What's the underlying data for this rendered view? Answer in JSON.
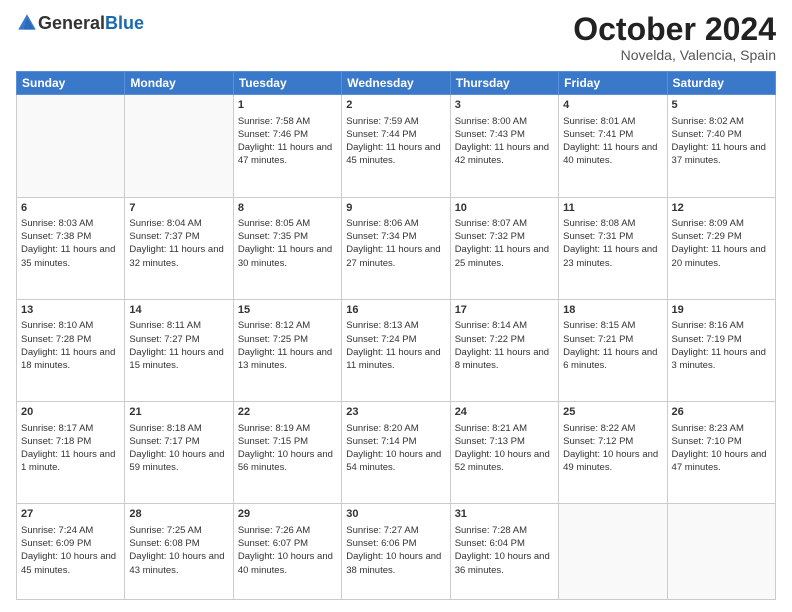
{
  "header": {
    "logo_general": "General",
    "logo_blue": "Blue",
    "title": "October 2024",
    "location": "Novelda, Valencia, Spain"
  },
  "days_of_week": [
    "Sunday",
    "Monday",
    "Tuesday",
    "Wednesday",
    "Thursday",
    "Friday",
    "Saturday"
  ],
  "weeks": [
    [
      {
        "day": "",
        "info": ""
      },
      {
        "day": "",
        "info": ""
      },
      {
        "day": "1",
        "info": "Sunrise: 7:58 AM\nSunset: 7:46 PM\nDaylight: 11 hours and 47 minutes."
      },
      {
        "day": "2",
        "info": "Sunrise: 7:59 AM\nSunset: 7:44 PM\nDaylight: 11 hours and 45 minutes."
      },
      {
        "day": "3",
        "info": "Sunrise: 8:00 AM\nSunset: 7:43 PM\nDaylight: 11 hours and 42 minutes."
      },
      {
        "day": "4",
        "info": "Sunrise: 8:01 AM\nSunset: 7:41 PM\nDaylight: 11 hours and 40 minutes."
      },
      {
        "day": "5",
        "info": "Sunrise: 8:02 AM\nSunset: 7:40 PM\nDaylight: 11 hours and 37 minutes."
      }
    ],
    [
      {
        "day": "6",
        "info": "Sunrise: 8:03 AM\nSunset: 7:38 PM\nDaylight: 11 hours and 35 minutes."
      },
      {
        "day": "7",
        "info": "Sunrise: 8:04 AM\nSunset: 7:37 PM\nDaylight: 11 hours and 32 minutes."
      },
      {
        "day": "8",
        "info": "Sunrise: 8:05 AM\nSunset: 7:35 PM\nDaylight: 11 hours and 30 minutes."
      },
      {
        "day": "9",
        "info": "Sunrise: 8:06 AM\nSunset: 7:34 PM\nDaylight: 11 hours and 27 minutes."
      },
      {
        "day": "10",
        "info": "Sunrise: 8:07 AM\nSunset: 7:32 PM\nDaylight: 11 hours and 25 minutes."
      },
      {
        "day": "11",
        "info": "Sunrise: 8:08 AM\nSunset: 7:31 PM\nDaylight: 11 hours and 23 minutes."
      },
      {
        "day": "12",
        "info": "Sunrise: 8:09 AM\nSunset: 7:29 PM\nDaylight: 11 hours and 20 minutes."
      }
    ],
    [
      {
        "day": "13",
        "info": "Sunrise: 8:10 AM\nSunset: 7:28 PM\nDaylight: 11 hours and 18 minutes."
      },
      {
        "day": "14",
        "info": "Sunrise: 8:11 AM\nSunset: 7:27 PM\nDaylight: 11 hours and 15 minutes."
      },
      {
        "day": "15",
        "info": "Sunrise: 8:12 AM\nSunset: 7:25 PM\nDaylight: 11 hours and 13 minutes."
      },
      {
        "day": "16",
        "info": "Sunrise: 8:13 AM\nSunset: 7:24 PM\nDaylight: 11 hours and 11 minutes."
      },
      {
        "day": "17",
        "info": "Sunrise: 8:14 AM\nSunset: 7:22 PM\nDaylight: 11 hours and 8 minutes."
      },
      {
        "day": "18",
        "info": "Sunrise: 8:15 AM\nSunset: 7:21 PM\nDaylight: 11 hours and 6 minutes."
      },
      {
        "day": "19",
        "info": "Sunrise: 8:16 AM\nSunset: 7:19 PM\nDaylight: 11 hours and 3 minutes."
      }
    ],
    [
      {
        "day": "20",
        "info": "Sunrise: 8:17 AM\nSunset: 7:18 PM\nDaylight: 11 hours and 1 minute."
      },
      {
        "day": "21",
        "info": "Sunrise: 8:18 AM\nSunset: 7:17 PM\nDaylight: 10 hours and 59 minutes."
      },
      {
        "day": "22",
        "info": "Sunrise: 8:19 AM\nSunset: 7:15 PM\nDaylight: 10 hours and 56 minutes."
      },
      {
        "day": "23",
        "info": "Sunrise: 8:20 AM\nSunset: 7:14 PM\nDaylight: 10 hours and 54 minutes."
      },
      {
        "day": "24",
        "info": "Sunrise: 8:21 AM\nSunset: 7:13 PM\nDaylight: 10 hours and 52 minutes."
      },
      {
        "day": "25",
        "info": "Sunrise: 8:22 AM\nSunset: 7:12 PM\nDaylight: 10 hours and 49 minutes."
      },
      {
        "day": "26",
        "info": "Sunrise: 8:23 AM\nSunset: 7:10 PM\nDaylight: 10 hours and 47 minutes."
      }
    ],
    [
      {
        "day": "27",
        "info": "Sunrise: 7:24 AM\nSunset: 6:09 PM\nDaylight: 10 hours and 45 minutes."
      },
      {
        "day": "28",
        "info": "Sunrise: 7:25 AM\nSunset: 6:08 PM\nDaylight: 10 hours and 43 minutes."
      },
      {
        "day": "29",
        "info": "Sunrise: 7:26 AM\nSunset: 6:07 PM\nDaylight: 10 hours and 40 minutes."
      },
      {
        "day": "30",
        "info": "Sunrise: 7:27 AM\nSunset: 6:06 PM\nDaylight: 10 hours and 38 minutes."
      },
      {
        "day": "31",
        "info": "Sunrise: 7:28 AM\nSunset: 6:04 PM\nDaylight: 10 hours and 36 minutes."
      },
      {
        "day": "",
        "info": ""
      },
      {
        "day": "",
        "info": ""
      }
    ]
  ]
}
